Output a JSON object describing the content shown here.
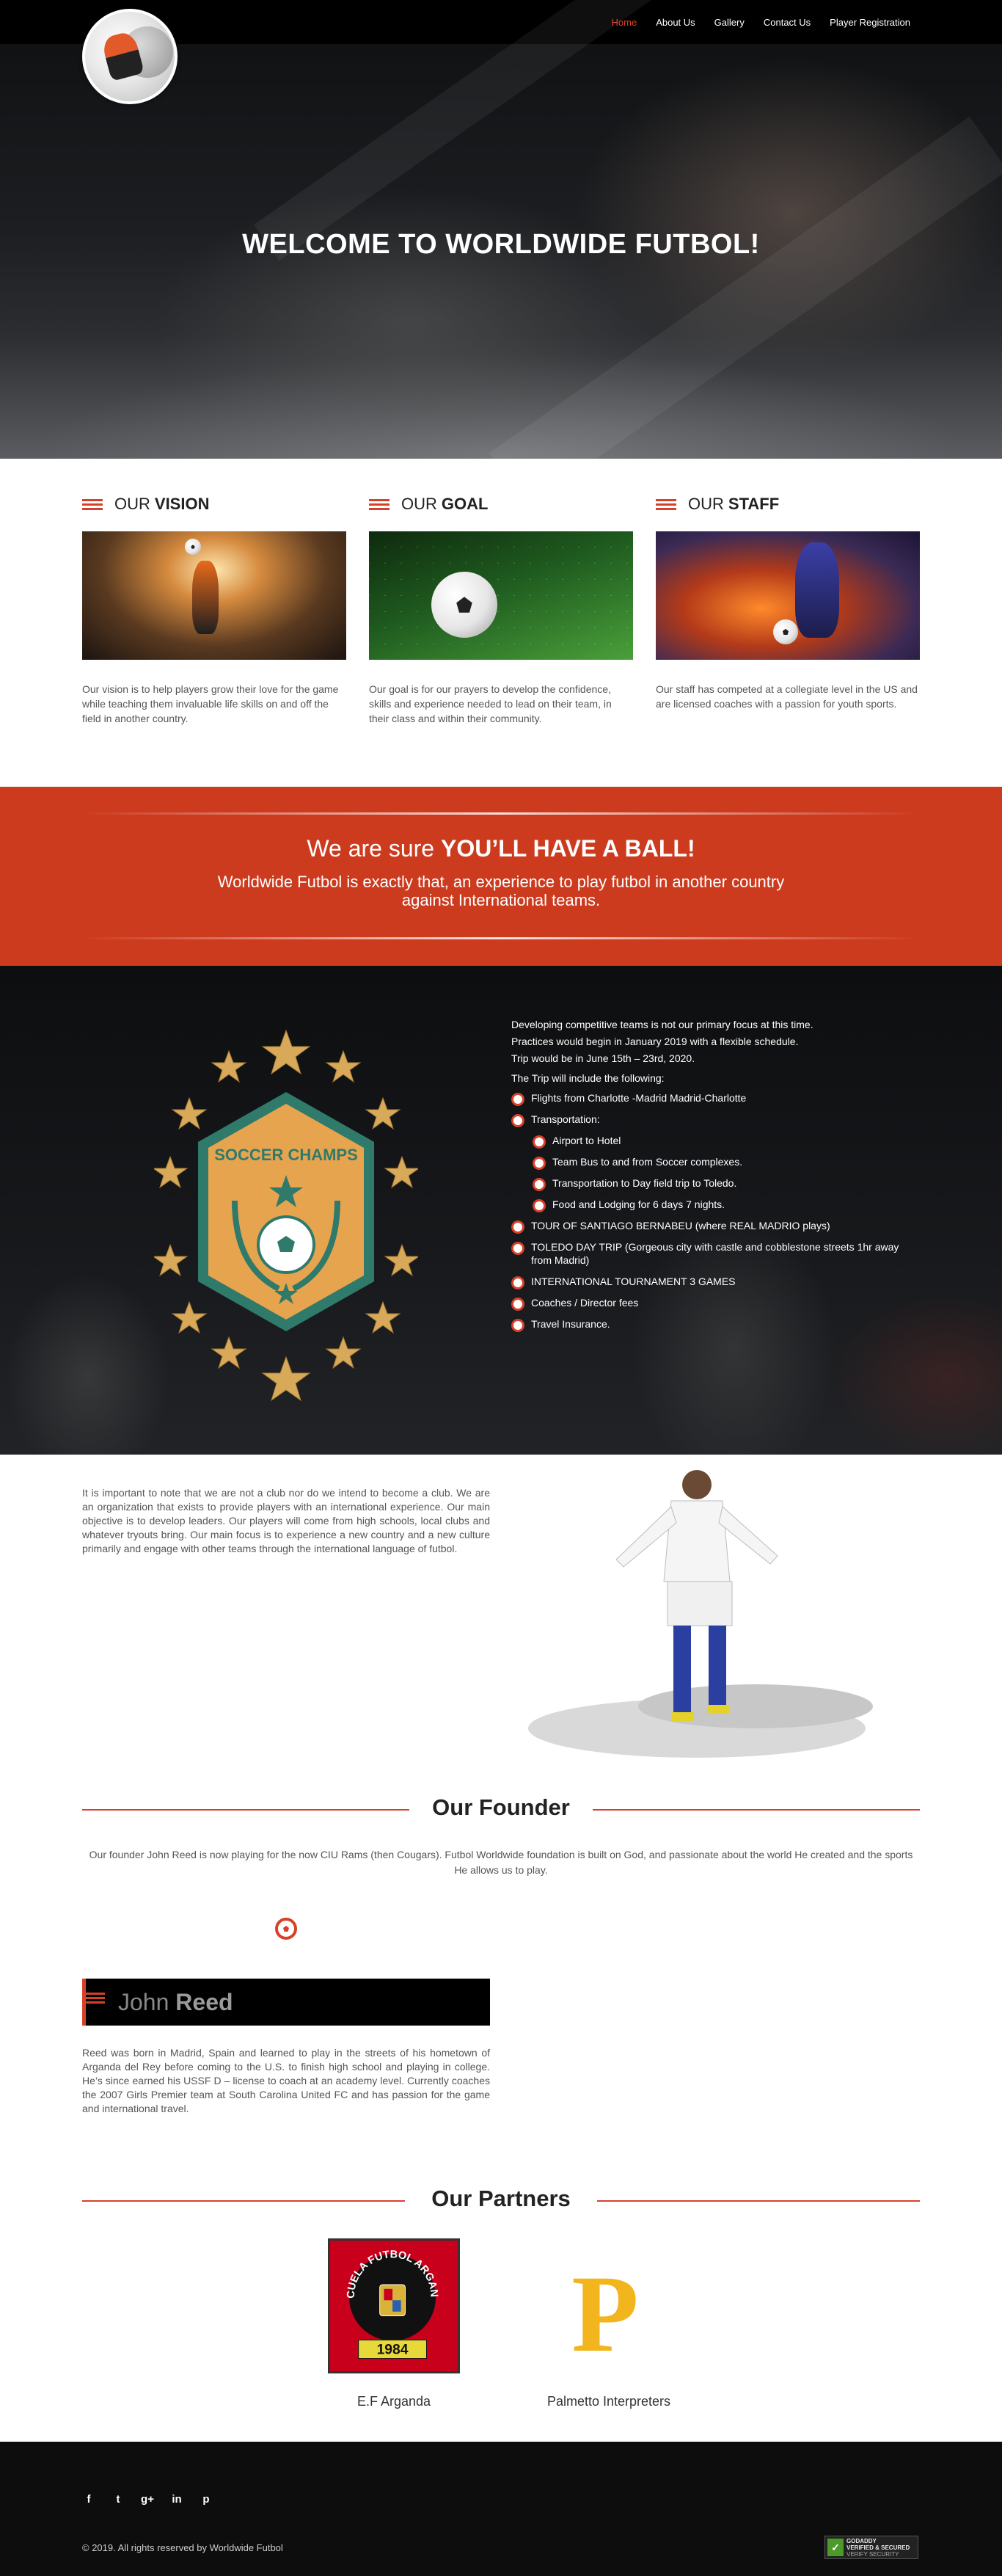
{
  "nav": {
    "items": [
      "Home",
      "About Us",
      "Gallery",
      "Contact Us",
      "Player Registration"
    ],
    "active": "Home"
  },
  "hero": {
    "title": "WELCOME TO WORLDWIDE FUTBOL!"
  },
  "features": [
    {
      "prefix": "OUR",
      "word": "VISION",
      "text": "Our vision is to help players grow their love for the game while teaching them invaluable life skills on and off the field in another country."
    },
    {
      "prefix": "OUR",
      "word": "GOAL",
      "text": "Our goal is for our prayers to develop the confidence, skills and experience needed to lead on their team, in their class and within their community."
    },
    {
      "prefix": "OUR",
      "word": "STAFF",
      "text": "Our staff has competed at a collegiate level in the US and are licensed coaches with a passion for youth sports."
    }
  ],
  "band": {
    "lead": "We are sure",
    "bold": "YOU’LL HAVE A BALL!",
    "text": "Worldwide Futbol is exactly that, an experience to play futbol in another country against International teams."
  },
  "trip": {
    "badge_text": "SOCCER CHAMPS",
    "intro_lines": [
      "Developing competitive teams is not our primary focus at this time.",
      "Practices would begin in January 2019 with a flexible schedule.",
      "Trip would be in June 15th – 23rd, 2020.",
      "The Trip will include the following:"
    ],
    "items": [
      {
        "text": "Flights from Charlotte -Madrid Madrid-Charlotte",
        "sub": false
      },
      {
        "text": "Transportation:",
        "sub": false
      },
      {
        "text": "Airport to Hotel",
        "sub": true
      },
      {
        "text": "Team Bus to and from Soccer complexes.",
        "sub": true
      },
      {
        "text": "Transportation to Day field trip to Toledo.",
        "sub": true
      },
      {
        "text": "Food and Lodging for 6 days 7 nights.",
        "sub": true
      },
      {
        "text": "TOUR OF SANTIAGO BERNABEU (where REAL MADRIO plays)",
        "sub": false
      },
      {
        "text": "TOLEDO DAY TRIP (Gorgeous city with castle and cobblestone streets 1hr away from Madrid)",
        "sub": false
      },
      {
        "text": "INTERNATIONAL TOURNAMENT 3 GAMES",
        "sub": false
      },
      {
        "text": "Coaches / Director fees",
        "sub": false
      },
      {
        "text": "Travel Insurance.",
        "sub": false
      }
    ]
  },
  "about": {
    "text": "It is important to note that we are not a club nor do we intend to become a club. We are an organization that exists to provide players with an international experience. Our main objective is to develop leaders. Our players will come from high schools, local clubs and whatever tryouts bring. Our main focus is to experience a new country and a new culture primarily and engage with other teams through the international language of futbol."
  },
  "founder": {
    "heading": "Our Founder",
    "intro": "Our founder John Reed is now playing for the now CIU Rams (then Cougars). Futbol Worldwide foundation is built on God, and passionate about the world He created and the sports He allows us to play.",
    "first_name": "John",
    "last_name": "Reed",
    "bio": "Reed was born in Madrid, Spain and learned to play in the streets of his hometown of Arganda del Rey before coming to the U.S. to finish high school and playing in college. He’s since earned his USSF D – license to coach at an academy level. Currently coaches the 2007 Girls Premier team at South Carolina United FC and has passion for the game and international travel."
  },
  "partners": {
    "heading": "Our Partners",
    "items": [
      {
        "name": "E.F Arganda",
        "logo_text": "ESCUELA FUTBOL ARGANDA",
        "logo_year": "1984"
      },
      {
        "name": "Palmetto Interpreters",
        "logo_letter": "P"
      }
    ]
  },
  "footer": {
    "social": [
      "f",
      "t",
      "g+",
      "in",
      "p"
    ],
    "copyright": "© 2019. All rights reserved by Worldwide Futbol",
    "seal_line1": "GODADDY",
    "seal_line2": "VERIFIED & SECURED",
    "seal_line3": "VERIFY SECURITY"
  },
  "colors": {
    "accent": "#d6412a",
    "band": "#cd3b1f",
    "dark": "#0d0d0d"
  }
}
